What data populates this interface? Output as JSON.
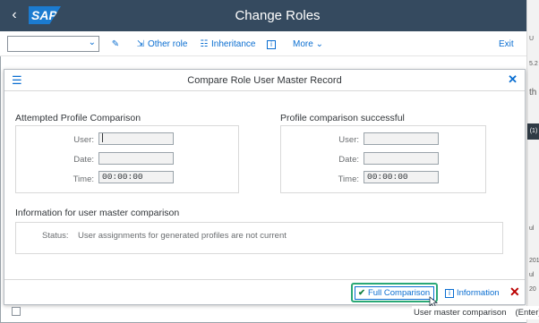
{
  "shell": {
    "back_icon": "chevron-left-icon",
    "logo_text": "SAP",
    "title": "Change Roles"
  },
  "toolbar": {
    "combo_value": "",
    "other_role": "Other role",
    "inheritance": "Inheritance",
    "more": "More",
    "exit": "Exit"
  },
  "right_strip": {
    "frag1": "U",
    "frag2": "5.2",
    "frag3": "th",
    "frag4": "(1)",
    "frag5": "ul",
    "frag6": "201",
    "frag7": "ul",
    "frag8": "20"
  },
  "dialog": {
    "title": "Compare Role User Master Record",
    "attempted": {
      "title": "Attempted Profile Comparison",
      "user_label": "User:",
      "user_value": "",
      "date_label": "Date:",
      "date_value": "",
      "time_label": "Time:",
      "time_value": "00:00:00"
    },
    "successful": {
      "title": "Profile comparison successful",
      "user_label": "User:",
      "user_value": "",
      "date_label": "Date:",
      "date_value": "",
      "time_label": "Time:",
      "time_value": "00:00:00"
    },
    "info": {
      "title": "Information for user master comparison",
      "status_label": "Status:",
      "status_value": "User assignments for generated profiles are not current"
    },
    "footer": {
      "full_comparison": "Full Comparison",
      "information": "Information"
    }
  },
  "tooltip": {
    "text": "User master comparison",
    "key": "(Enter)"
  },
  "colors": {
    "shell": "#354a5f",
    "accent": "#0a6ed1",
    "highlight": "#2aa876",
    "cancel": "#bb0000"
  }
}
